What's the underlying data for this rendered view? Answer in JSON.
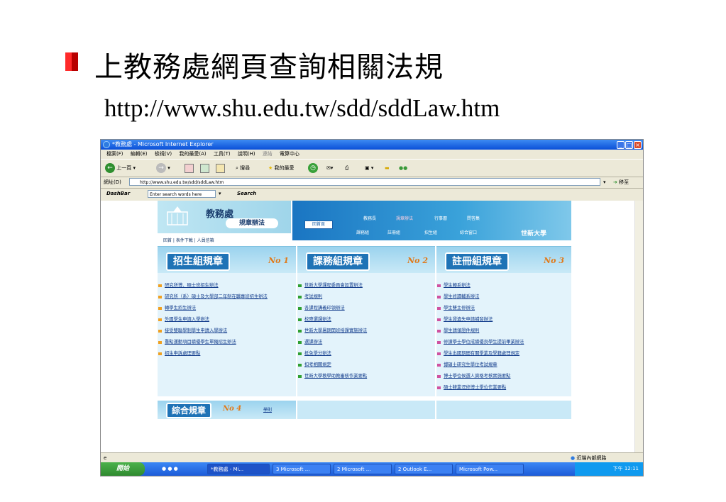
{
  "slide": {
    "title": "上教務處網頁查詢相關法規",
    "url": "http://www.shu.edu.tw/sdd/sddLaw.htm"
  },
  "browser": {
    "window_title": "*教務處 - Microsoft Internet Explorer",
    "menu": [
      "檔案(F)",
      "編輯(E)",
      "檢視(V)",
      "我的最愛(A)",
      "工具(T)",
      "說明(H)",
      "連結",
      "電算中心"
    ],
    "toolbar": {
      "back": "上一頁",
      "search": "搜尋",
      "favorites": "我的最愛"
    },
    "address_label": "網址(D)",
    "address_value": "http://www.shu.edu.tw/sdd/sddLaw.htm",
    "go_label": "移至",
    "dashbar": {
      "label": "DashBar",
      "input_value": "Enter search words here",
      "search": "Search"
    }
  },
  "page": {
    "site_name": "教務處",
    "site_sub": "規章辦法",
    "home": "回首頁",
    "nav": [
      "教務長",
      "規章辦法",
      "行事曆",
      "問答集",
      "課務組",
      "註冊組",
      "招生組",
      "綜合窗口"
    ],
    "university": "世新大學",
    "top_menu": "回首 | 表件下載 | 人員信箱",
    "columns": [
      {
        "title": "招生組規章",
        "no": "No 1",
        "items": [
          "研究所博、碩士班招生辦法",
          "研究所（系）碩士及大學部二年制在職專班招生辦法",
          "轉學生招生辦法",
          "外國學生申請入學辦法",
          "接受雙聯學制學生申請入學辦法",
          "重點運動項目績優學生單獨招生辦法",
          "招生申訴處理要點"
        ]
      },
      {
        "title": "課務組規章",
        "no": "No 2",
        "items": [
          "世新大學課程委員會設置辦法",
          "考試規則",
          "各課程講義印領辦法",
          "校際選課辦法",
          "世新大學暑期開班授課實施辦法",
          "選課辦法",
          "抵免學分辦法",
          "扣考相關規定",
          "世新大學教學助教審核作業要點"
        ]
      },
      {
        "title": "註冊組規章",
        "no": "No 3",
        "items": [
          "學生轉系辦法",
          "學生修讀輔系辦法",
          "學生雙主修辦法",
          "學生證遺失申請補發辦法",
          "學生請領證件規則",
          "修讀學士學位成績優良學生提前畢業辦法",
          "學生出國期間有關學業及學籍處理規定",
          "博碩士研究生學位考試規章",
          "博士學位候選人資格考核實施要點",
          "碩士肄業逕修博士學位作業要點"
        ]
      }
    ],
    "bottom": {
      "title": "綜合規章",
      "no": "No 4",
      "link": "學則"
    }
  },
  "status": {
    "zone": "近端內部網路"
  },
  "taskbar": {
    "start": "開始",
    "tasks": [
      "*教務處 - Mi...",
      "3 Microsoft ...",
      "2 Microsoft ...",
      "2 Outlook E...",
      "Microsoft Pow..."
    ],
    "clock": "下午 12:11"
  },
  "colors": {
    "accent_blue": "#1f73b6",
    "bullet_red": "#e00000",
    "no_orange": "#e07a1a"
  }
}
